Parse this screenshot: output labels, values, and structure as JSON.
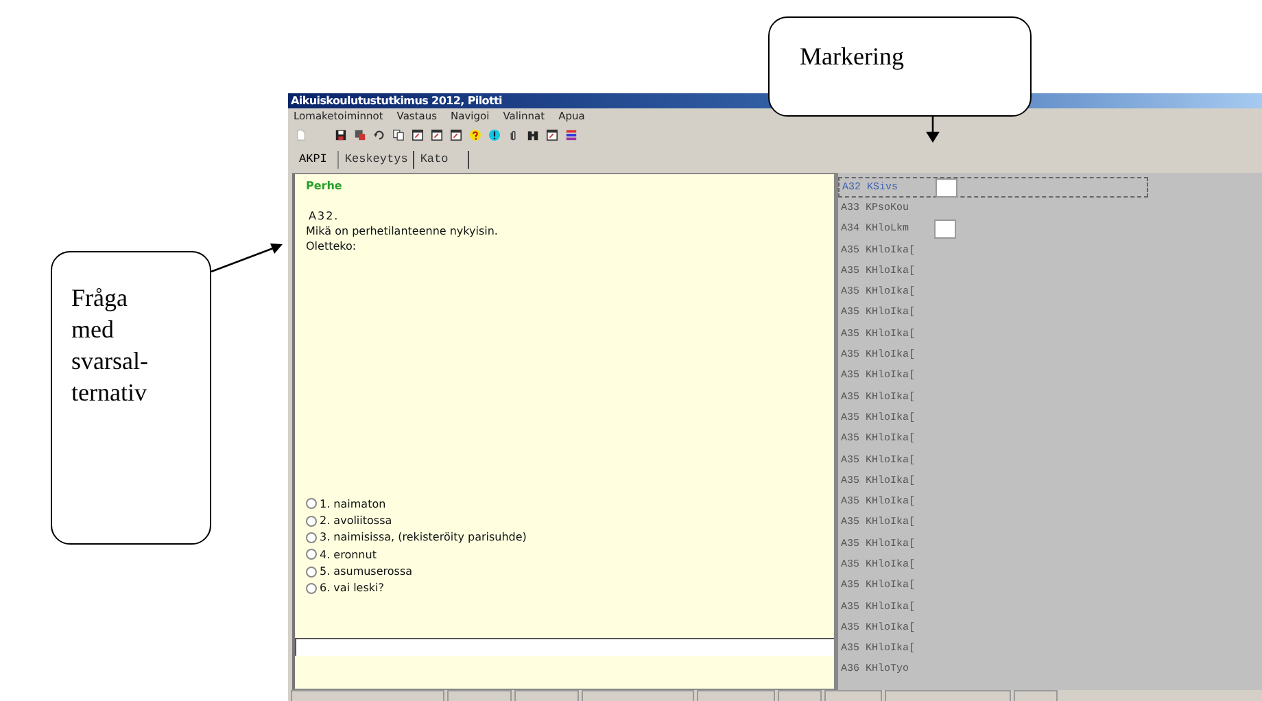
{
  "window": {
    "title": "Aikuiskoulutustutkimus 2012, Pilotti"
  },
  "menu": [
    "Lomaketoiminnot",
    "Vastaus",
    "Navigoi",
    "Valinnat",
    "Apua"
  ],
  "tabs": [
    {
      "label": "AKPI",
      "selected": true
    },
    {
      "label": "Keskeytys",
      "selected": false
    },
    {
      "label": "Kato",
      "selected": false
    }
  ],
  "question": {
    "section": "Perhe",
    "number": "A32.",
    "text": "Mikä on perhetilanteenne nykyisin.",
    "prompt": "Oletteko:",
    "options": [
      {
        "label": "1. naimaton",
        "checked": false
      },
      {
        "label": "2. avoliitossa",
        "checked": false
      },
      {
        "label": "3. naimisissa, (rekisteröity parisuhde)",
        "checked": false
      },
      {
        "label": "4. eronnut",
        "checked": false
      },
      {
        "label": "5. asumuserossa",
        "checked": false
      },
      {
        "label": "6. vai leski?",
        "checked": false
      }
    ]
  },
  "fields": [
    {
      "label": "A32 KSivs",
      "selected": true,
      "kind": "input"
    },
    {
      "label": "A33 KPsoKou",
      "selected": false,
      "kind": "text"
    },
    {
      "label": "A34 KHloLkm",
      "selected": false,
      "kind": "input"
    },
    {
      "label": "A35 KHloIka[",
      "selected": false,
      "kind": "text"
    },
    {
      "label": "A35 KHloIka[",
      "selected": false,
      "kind": "text"
    },
    {
      "label": "A35 KHloIka[",
      "selected": false,
      "kind": "text"
    },
    {
      "label": "A35 KHloIka[",
      "selected": false,
      "kind": "text"
    },
    {
      "label": "A35 KHloIka[",
      "selected": false,
      "kind": "text"
    },
    {
      "label": "A35 KHloIka[",
      "selected": false,
      "kind": "text"
    },
    {
      "label": "A35 KHloIka[",
      "selected": false,
      "kind": "text"
    },
    {
      "label": "A35 KHloIka[",
      "selected": false,
      "kind": "text"
    },
    {
      "label": "A35 KHloIka[",
      "selected": false,
      "kind": "text"
    },
    {
      "label": "A35 KHloIka[",
      "selected": false,
      "kind": "text"
    },
    {
      "label": "A35 KHloIka[",
      "selected": false,
      "kind": "text"
    },
    {
      "label": "A35 KHloIka[",
      "selected": false,
      "kind": "text"
    },
    {
      "label": "A35 KHloIka[",
      "selected": false,
      "kind": "text"
    },
    {
      "label": "A35 KHloIka[",
      "selected": false,
      "kind": "text"
    },
    {
      "label": "A35 KHloIka[",
      "selected": false,
      "kind": "text"
    },
    {
      "label": "A35 KHloIka[",
      "selected": false,
      "kind": "text"
    },
    {
      "label": "A35 KHloIka[",
      "selected": false,
      "kind": "text"
    },
    {
      "label": "A35 KHloIka[",
      "selected": false,
      "kind": "text"
    },
    {
      "label": "A35 KHloIka[",
      "selected": false,
      "kind": "text"
    },
    {
      "label": "A35 KHloIka[",
      "selected": false,
      "kind": "text"
    },
    {
      "label": "A36 KHloTyo",
      "selected": false,
      "kind": "text"
    }
  ],
  "callouts": [
    {
      "kind": "left",
      "lines": [
        "Fråga",
        "med",
        "svarsal-",
        "ternativ"
      ]
    },
    {
      "kind": "top",
      "lines": [
        "Markering"
      ]
    }
  ]
}
